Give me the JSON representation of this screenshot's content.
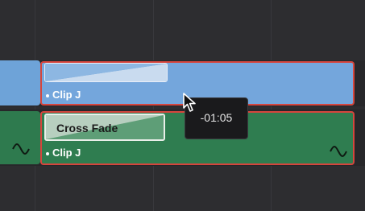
{
  "timeline": {
    "video_track": {
      "clip": {
        "label": "Clip J"
      }
    },
    "audio_track": {
      "clip": {
        "label": "Clip J"
      },
      "transition": {
        "title": "Cross Fade"
      },
      "left_curve_icon": "audio-fade-curve-icon",
      "right_curve_icon": "audio-fade-curve-icon"
    }
  },
  "tooltip": {
    "text": "-01:05"
  },
  "colors": {
    "video_clip": "#74a6dc",
    "audio_clip": "#2f7d50",
    "selection_border": "#d6453d",
    "tooltip_bg": "#1a1a1c"
  }
}
